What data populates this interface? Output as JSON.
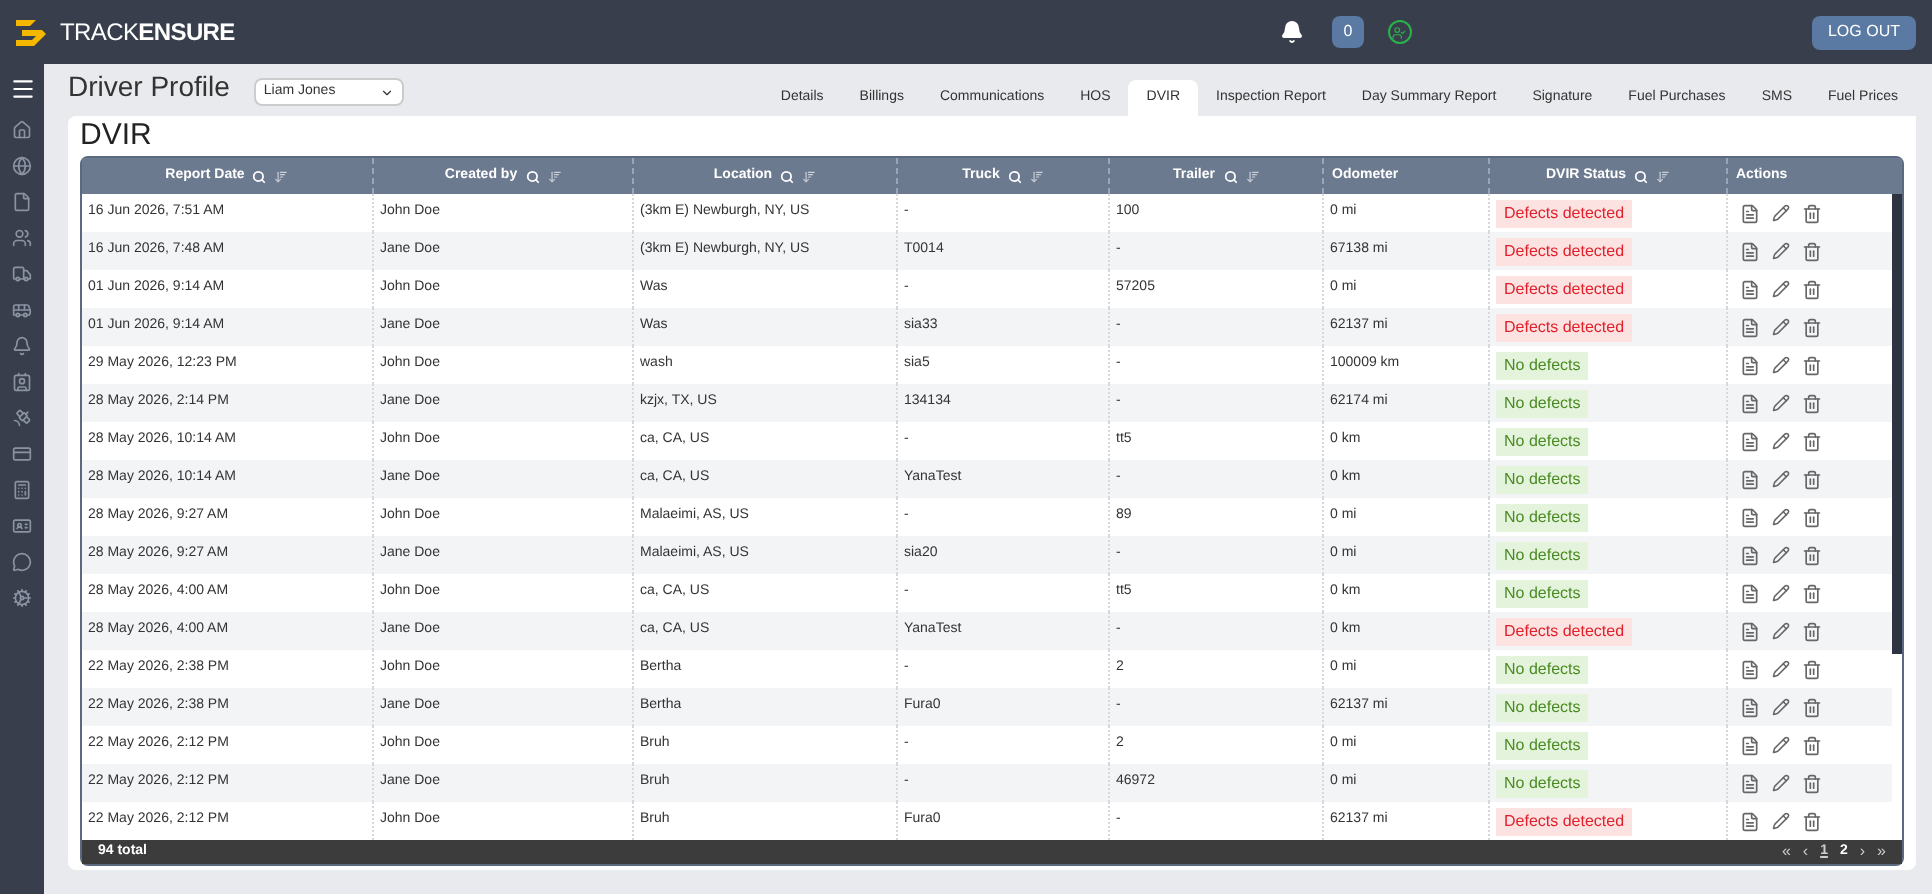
{
  "header": {
    "logo": {
      "part1": "TRACK",
      "part2": "ENSURE"
    },
    "notification_count": "0",
    "logout": "LOG OUT"
  },
  "page": {
    "title": "Driver Profile",
    "driver_select": "Liam Jones"
  },
  "tabs": [
    {
      "label": "Details",
      "selected": false
    },
    {
      "label": "Billings",
      "selected": false
    },
    {
      "label": "Communications",
      "selected": false
    },
    {
      "label": "HOS",
      "selected": false
    },
    {
      "label": "DVIR",
      "selected": true
    },
    {
      "label": "Inspection Report",
      "selected": false
    },
    {
      "label": "Day Summary Report",
      "selected": false
    },
    {
      "label": "Signature",
      "selected": false
    },
    {
      "label": "Fuel Purchases",
      "selected": false
    },
    {
      "label": "SMS",
      "selected": false
    },
    {
      "label": "Fuel Prices",
      "selected": false
    }
  ],
  "section_title": "DVIR",
  "table": {
    "columns": [
      {
        "label": "Report Date",
        "filterable": true
      },
      {
        "label": "Created by",
        "filterable": true
      },
      {
        "label": "Location",
        "filterable": true
      },
      {
        "label": "Truck",
        "filterable": true
      },
      {
        "label": "Trailer",
        "filterable": true
      },
      {
        "label": "Odometer",
        "filterable": false
      },
      {
        "label": "DVIR Status",
        "filterable": true
      },
      {
        "label": "Actions",
        "filterable": false
      }
    ],
    "rows": [
      {
        "date": "16 Jun 2026, 7:51 AM",
        "created_by": "John Doe",
        "location": "(3km E) Newburgh, NY, US",
        "truck": "-",
        "trailer": "100",
        "odometer": "0 mi",
        "status": "Defects detected",
        "kind": "defects"
      },
      {
        "date": "16 Jun 2026, 7:48 AM",
        "created_by": "Jane Doe",
        "location": "(3km E) Newburgh, NY, US",
        "truck": "T0014",
        "trailer": "-",
        "odometer": "67138 mi",
        "status": "Defects detected",
        "kind": "defects"
      },
      {
        "date": "01 Jun 2026, 9:14 AM",
        "created_by": "John Doe",
        "location": "Was",
        "truck": "-",
        "trailer": "57205",
        "odometer": "0 mi",
        "status": "Defects detected",
        "kind": "defects"
      },
      {
        "date": "01 Jun 2026, 9:14 AM",
        "created_by": "Jane Doe",
        "location": "Was",
        "truck": "sia33",
        "trailer": "-",
        "odometer": "62137 mi",
        "status": "Defects detected",
        "kind": "defects"
      },
      {
        "date": "29 May 2026, 12:23 PM",
        "created_by": "John Doe",
        "location": "wash",
        "truck": "sia5",
        "trailer": "-",
        "odometer": "100009 km",
        "status": "No defects",
        "kind": "ok"
      },
      {
        "date": "28 May 2026, 2:14 PM",
        "created_by": "Jane Doe",
        "location": "kzjx, TX, US",
        "truck": "134134",
        "trailer": "-",
        "odometer": "62174 mi",
        "status": "No defects",
        "kind": "ok"
      },
      {
        "date": "28 May 2026, 10:14 AM",
        "created_by": "John Doe",
        "location": "ca, CA, US",
        "truck": "-",
        "trailer": "tt5",
        "odometer": "0 km",
        "status": "No defects",
        "kind": "ok"
      },
      {
        "date": "28 May 2026, 10:14 AM",
        "created_by": "Jane Doe",
        "location": "ca, CA, US",
        "truck": "YanaTest",
        "trailer": "-",
        "odometer": "0 km",
        "status": "No defects",
        "kind": "ok"
      },
      {
        "date": "28 May 2026, 9:27 AM",
        "created_by": "John Doe",
        "location": "Malaeimi, AS, US",
        "truck": "-",
        "trailer": "89",
        "odometer": "0 mi",
        "status": "No defects",
        "kind": "ok"
      },
      {
        "date": "28 May 2026, 9:27 AM",
        "created_by": "Jane Doe",
        "location": "Malaeimi, AS, US",
        "truck": "sia20",
        "trailer": "-",
        "odometer": "0 mi",
        "status": "No defects",
        "kind": "ok"
      },
      {
        "date": "28 May 2026, 4:00 AM",
        "created_by": "John Doe",
        "location": "ca, CA, US",
        "truck": "-",
        "trailer": "tt5",
        "odometer": "0 km",
        "status": "No defects",
        "kind": "ok"
      },
      {
        "date": "28 May 2026, 4:00 AM",
        "created_by": "Jane Doe",
        "location": "ca, CA, US",
        "truck": "YanaTest",
        "trailer": "-",
        "odometer": "0 km",
        "status": "Defects detected",
        "kind": "defects"
      },
      {
        "date": "22 May 2026, 2:38 PM",
        "created_by": "John Doe",
        "location": "Bertha",
        "truck": "-",
        "trailer": "2",
        "odometer": "0 mi",
        "status": "No defects",
        "kind": "ok"
      },
      {
        "date": "22 May 2026, 2:38 PM",
        "created_by": "Jane Doe",
        "location": "Bertha",
        "truck": "Fura0",
        "trailer": "-",
        "odometer": "62137 mi",
        "status": "No defects",
        "kind": "ok"
      },
      {
        "date": "22 May 2026, 2:12 PM",
        "created_by": "John Doe",
        "location": "Bruh",
        "truck": "-",
        "trailer": "2",
        "odometer": "0 mi",
        "status": "No defects",
        "kind": "ok"
      },
      {
        "date": "22 May 2026, 2:12 PM",
        "created_by": "Jane Doe",
        "location": "Bruh",
        "truck": "-",
        "trailer": "46972",
        "odometer": "0 mi",
        "status": "No defects",
        "kind": "ok"
      },
      {
        "date": "22 May 2026, 2:12 PM",
        "created_by": "John Doe",
        "location": "Bruh",
        "truck": "Fura0",
        "trailer": "-",
        "odometer": "62137 mi",
        "status": "Defects detected",
        "kind": "defects"
      }
    ],
    "total": "94 total",
    "pagination": [
      {
        "label": "«",
        "kind": "nav"
      },
      {
        "label": "‹",
        "kind": "nav"
      },
      {
        "label": "1",
        "kind": "page",
        "selected": true
      },
      {
        "label": "2",
        "kind": "page",
        "selected": false
      },
      {
        "label": "›",
        "kind": "nav"
      },
      {
        "label": "»",
        "kind": "nav"
      }
    ]
  }
}
